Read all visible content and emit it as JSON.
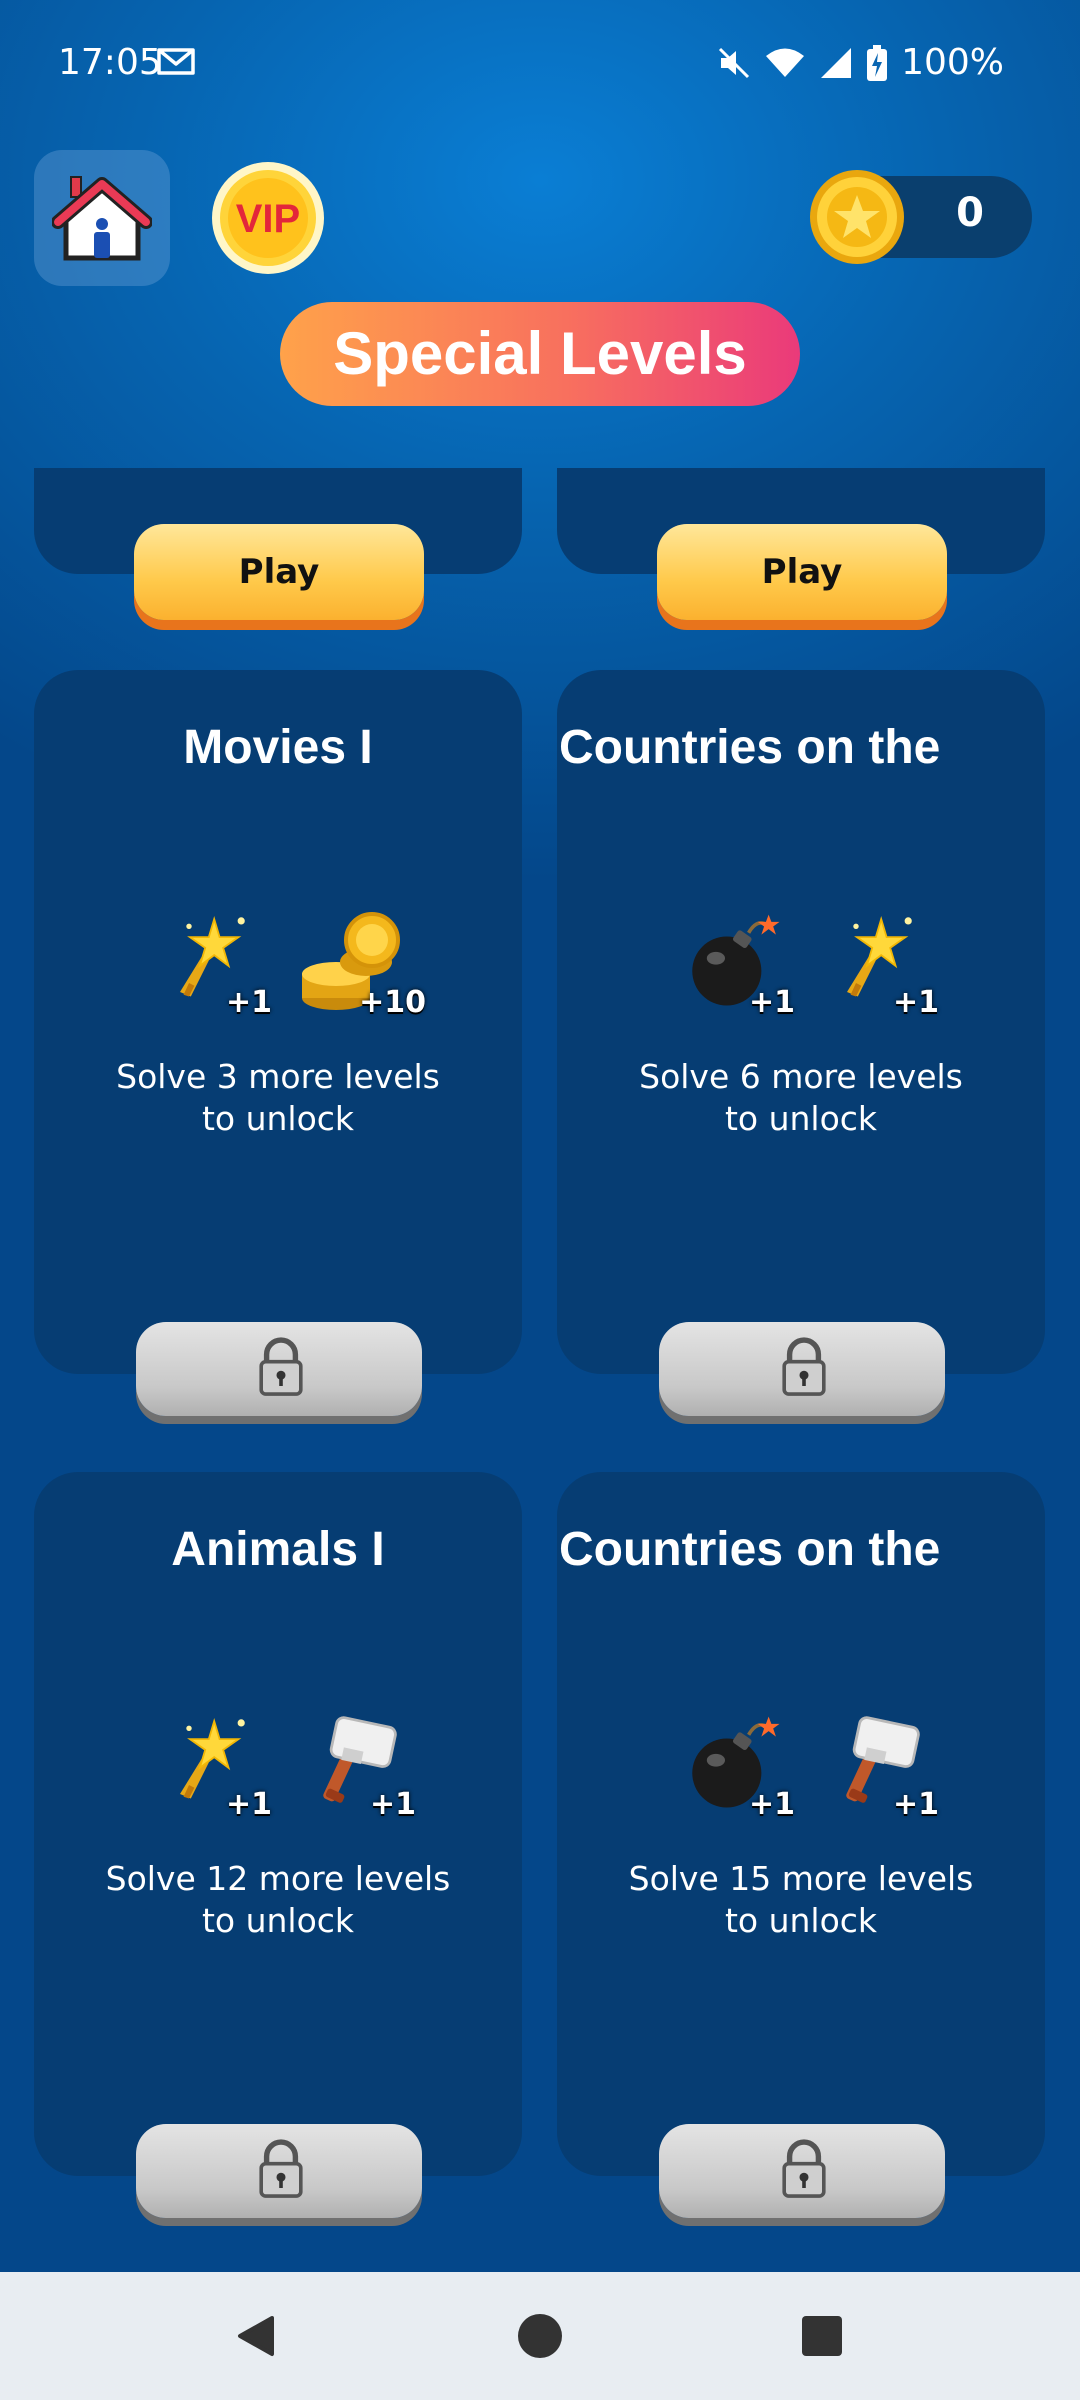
{
  "status_bar": {
    "time": "17:05",
    "battery": "100%",
    "icons": [
      "gmail-icon",
      "mute-icon",
      "wifi-icon",
      "signal-icon",
      "battery-charging-icon"
    ]
  },
  "header": {
    "home_icon": "house-icon",
    "vip_label": "VIP",
    "coin_count": "0"
  },
  "page_title": "Special Levels",
  "top_cards": [
    {
      "button_label": "Play"
    },
    {
      "button_label": "Play"
    }
  ],
  "cards": [
    {
      "title": "Movies I",
      "rewards": [
        {
          "icon": "magic-wand-icon",
          "amount": "+1"
        },
        {
          "icon": "coins-icon",
          "amount": "+10"
        }
      ],
      "desc_line1": "Solve 3 more levels",
      "desc_line2": "to unlock",
      "state": "locked"
    },
    {
      "title": "Countries on the",
      "rewards": [
        {
          "icon": "bomb-icon",
          "amount": "+1"
        },
        {
          "icon": "magic-wand-icon",
          "amount": "+1"
        }
      ],
      "desc_line1": "Solve 6 more levels",
      "desc_line2": "to unlock",
      "state": "locked"
    },
    {
      "title": "Animals I",
      "rewards": [
        {
          "icon": "magic-wand-icon",
          "amount": "+1"
        },
        {
          "icon": "hammer-icon",
          "amount": "+1"
        }
      ],
      "desc_line1": "Solve 12 more levels",
      "desc_line2": "to unlock",
      "state": "locked"
    },
    {
      "title": "Countries on the",
      "rewards": [
        {
          "icon": "bomb-icon",
          "amount": "+1"
        },
        {
          "icon": "hammer-icon",
          "amount": "+1"
        }
      ],
      "desc_line1": "Solve 15 more levels",
      "desc_line2": "to unlock",
      "state": "locked"
    }
  ],
  "colors": {
    "background": "#0664b0",
    "card": "#063d73",
    "play_button": "#ffc94a",
    "title_gradient_start": "#ffa24a",
    "title_gradient_end": "#ea3a7a"
  }
}
